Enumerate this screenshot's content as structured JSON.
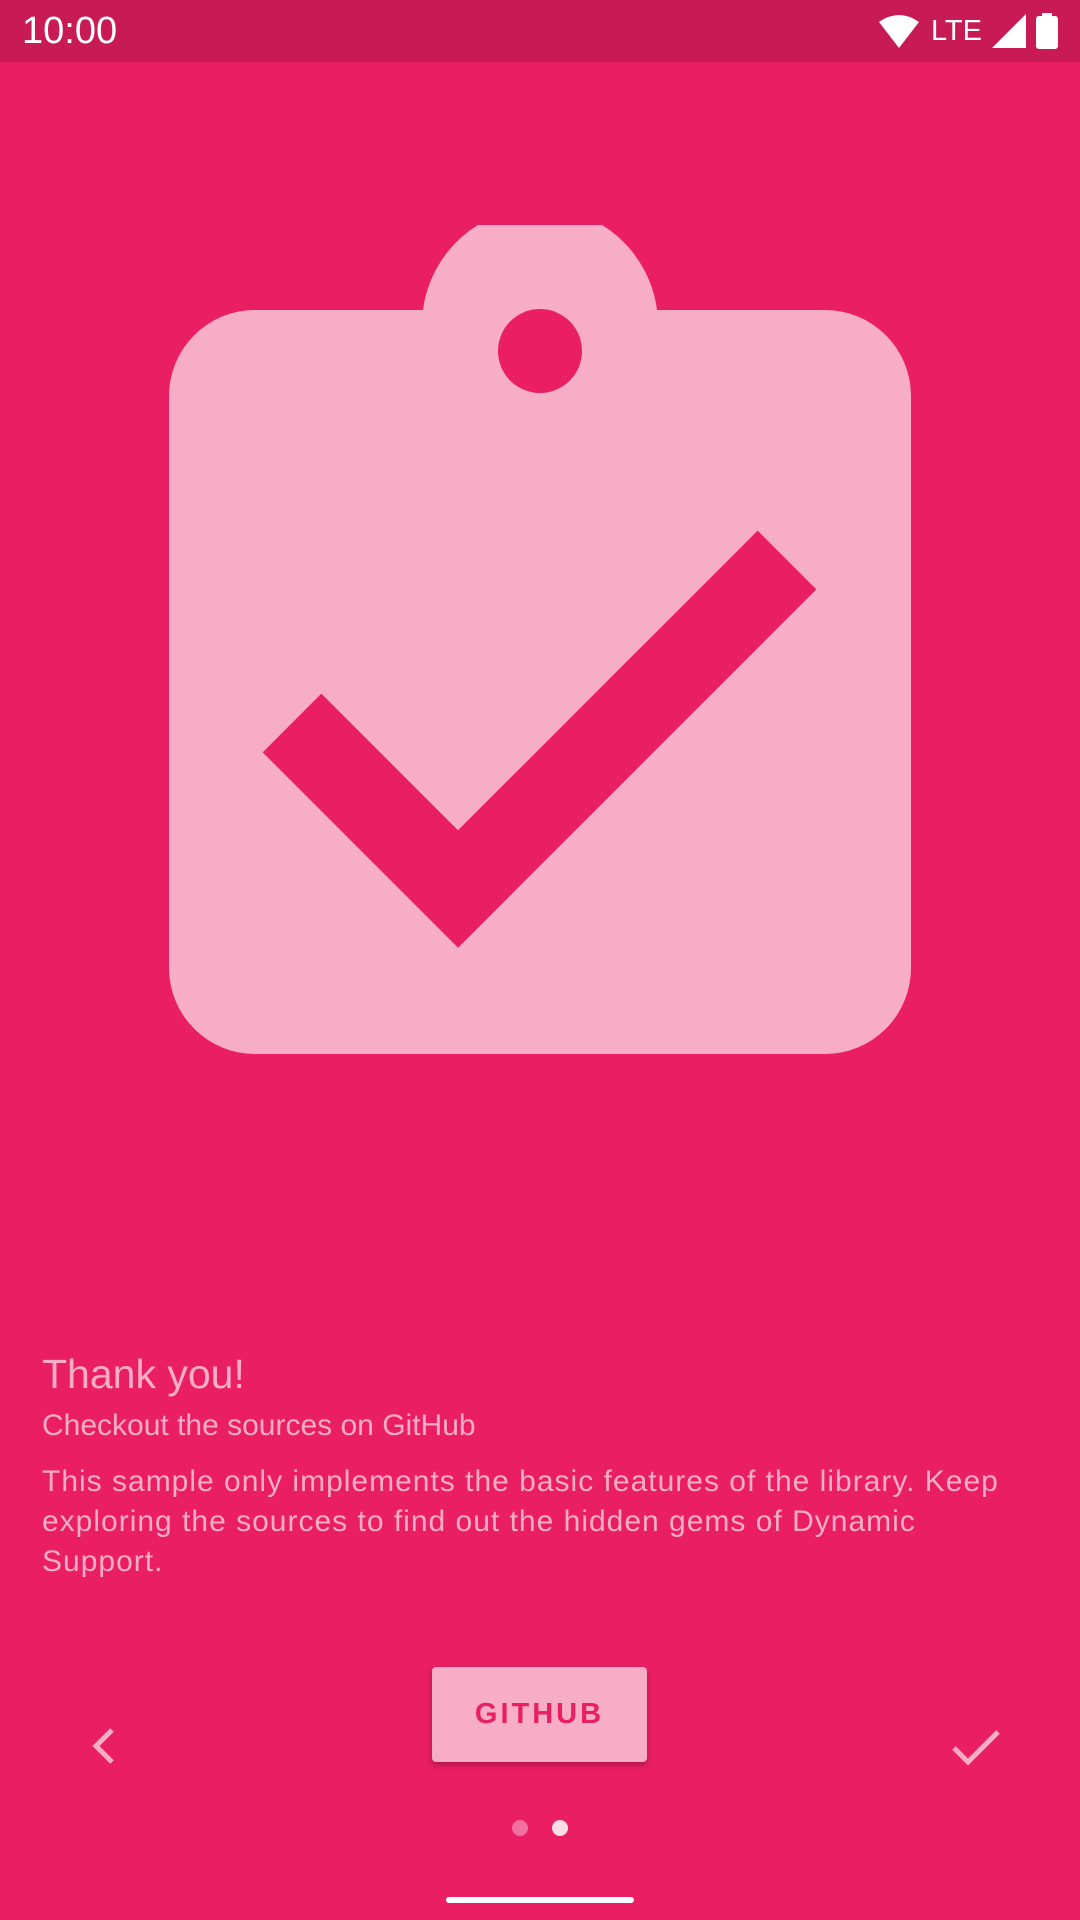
{
  "status_bar": {
    "time": "10:00",
    "network": "LTE"
  },
  "content": {
    "title": "Thank you!",
    "subtitle": "Checkout the sources on GitHub",
    "description": "This sample only implements the basic features of the library. Keep exploring the sources to find out the hidden gems of Dynamic Support."
  },
  "actions": {
    "github_label": "GITHUB"
  },
  "icons": {
    "hero": "clipboard-check-icon",
    "prev": "chevron-left-icon",
    "done": "check-icon"
  },
  "pager": {
    "total": 2,
    "current": 2
  },
  "colors": {
    "background": "#E91E63",
    "status_bar": "#C81A55",
    "accent_light": "#F8ADC6"
  }
}
